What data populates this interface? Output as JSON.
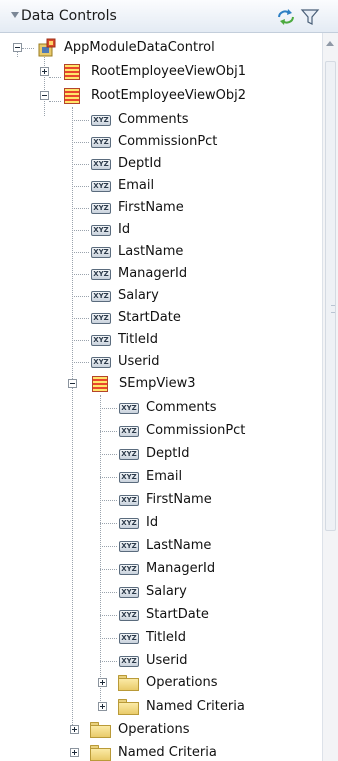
{
  "panel": {
    "title": "Data Controls",
    "refresh_icon": "refresh-icon",
    "filter_icon": "filter-icon"
  },
  "tree": {
    "root": {
      "label": "AppModuleDataControl",
      "icon": "app-module-icon",
      "expanded": true
    },
    "view1": {
      "label": "RootEmployeeViewObj1",
      "icon": "view-object-icon",
      "expanded": false
    },
    "view2": {
      "label": "RootEmployeeViewObj2",
      "icon": "view-object-icon",
      "expanded": true,
      "attributes": [
        "Comments",
        "CommissionPct",
        "DeptId",
        "Email",
        "FirstName",
        "Id",
        "LastName",
        "ManagerId",
        "Salary",
        "StartDate",
        "TitleId",
        "Userid"
      ]
    },
    "view3": {
      "label": "SEmpView3",
      "icon": "view-object-icon",
      "expanded": true,
      "attributes": [
        "Comments",
        "CommissionPct",
        "DeptId",
        "Email",
        "FirstName",
        "Id",
        "LastName",
        "ManagerId",
        "Salary",
        "StartDate",
        "TitleId",
        "Userid"
      ],
      "operations": "Operations",
      "named_criteria": "Named Criteria"
    },
    "view2_operations": "Operations",
    "view2_named_criteria": "Named Criteria"
  }
}
